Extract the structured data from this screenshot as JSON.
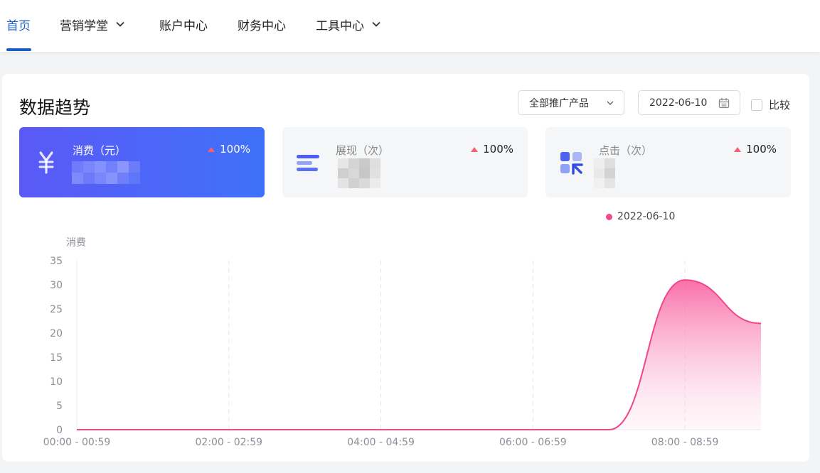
{
  "nav": {
    "items": [
      {
        "label": "首页",
        "active": true,
        "dropdown": false
      },
      {
        "label": "营销学堂",
        "active": false,
        "dropdown": true
      },
      {
        "label": "账户中心",
        "active": false,
        "dropdown": false
      },
      {
        "label": "财务中心",
        "active": false,
        "dropdown": false
      },
      {
        "label": "工具中心",
        "active": false,
        "dropdown": true
      }
    ]
  },
  "panel": {
    "title": "数据趋势",
    "product_select": "全部推广产品",
    "date": "2022-06-10",
    "compare_label": "比较",
    "compare_checked": false
  },
  "metrics": [
    {
      "label": "消费（元）",
      "change": "100%",
      "icon": "yuan-icon",
      "active": true
    },
    {
      "label": "展现（次）",
      "change": "100%",
      "icon": "impression-icon",
      "active": false
    },
    {
      "label": "点击（次）",
      "change": "100%",
      "icon": "click-icon",
      "active": false
    }
  ],
  "colors": {
    "accent": "#1f5fbf",
    "active_card_start": "#5b59f7",
    "active_card_end": "#3f71f8",
    "series": "#f0468a",
    "up_arrow": "#f56070"
  },
  "chart_data": {
    "type": "area",
    "ylabel": "消费",
    "ylim": [
      0,
      35
    ],
    "yticks": [
      0,
      5,
      10,
      15,
      20,
      25,
      30,
      35
    ],
    "xtick_labels": [
      "00:00 - 00:59",
      "02:00 - 02:59",
      "04:00 - 04:59",
      "06:00 - 06:59",
      "08:00 - 08:59"
    ],
    "legend_position": "top-right",
    "grid": "vertical-dashed",
    "series": [
      {
        "name": "2022-06-10",
        "x": [
          "00:00 - 00:59",
          "01:00 - 01:59",
          "02:00 - 02:59",
          "03:00 - 03:59",
          "04:00 - 04:59",
          "05:00 - 05:59",
          "06:00 - 06:59",
          "07:00 - 07:59",
          "08:00 - 08:59",
          "09:00 - 09:59"
        ],
        "values": [
          0,
          0,
          0,
          0,
          0,
          0,
          0,
          0,
          31,
          22
        ]
      }
    ]
  }
}
